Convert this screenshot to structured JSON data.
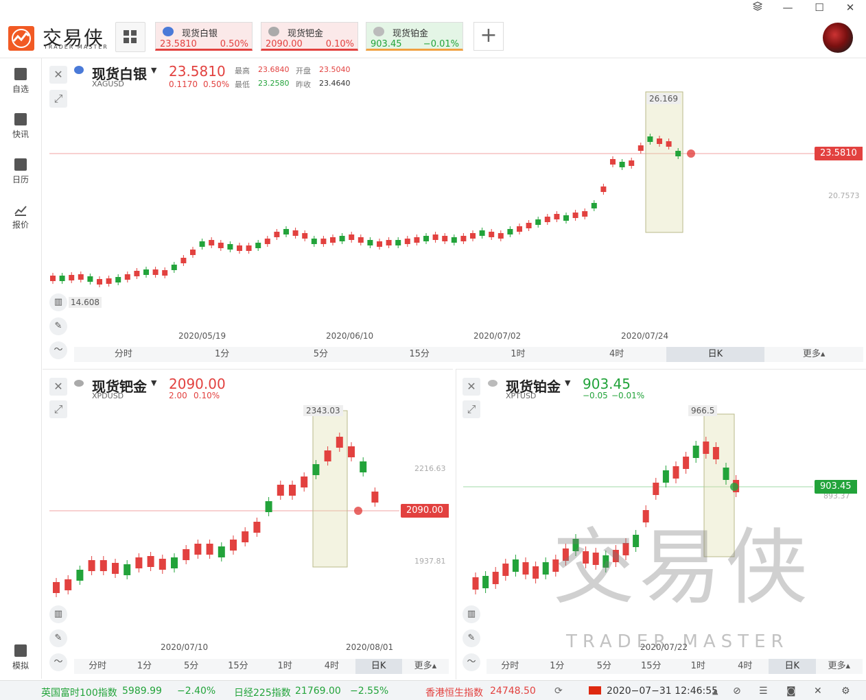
{
  "app": {
    "logo_text": "交易侠",
    "logo_sub": "TRADER MASTER",
    "watermark_text": "交易侠",
    "watermark_sub": "TRADER MASTER"
  },
  "window_controls": {
    "layers_icon": "layers-icon",
    "min": "—",
    "max": "☐",
    "close": "✕"
  },
  "tabs": [
    {
      "name": "现货白银",
      "price": "23.5810",
      "change": "0.50%",
      "color": "#e2413f",
      "bg": "#fbe9e9",
      "icon_color": "#4a7ad8"
    },
    {
      "name": "现货钯金",
      "price": "2090.00",
      "change": "0.10%",
      "color": "#e2413f",
      "bg": "#fbe9e9",
      "icon_color": "#aaaaaa"
    },
    {
      "name": "现货铂金",
      "price": "903.45",
      "change": "−0.01%",
      "color": "#22a33a",
      "bg": "#e4f5e6",
      "icon_color": "#bbbbbb"
    }
  ],
  "add_tab": "+",
  "sidebar": {
    "items": [
      {
        "label": "自选",
        "icon": "bookmark-add-icon"
      },
      {
        "label": "快讯",
        "icon": "news-icon"
      },
      {
        "label": "日历",
        "icon": "calendar-icon"
      },
      {
        "label": "报价",
        "icon": "chart-line-icon"
      }
    ],
    "bottom": {
      "label": "模拟",
      "icon": "wallet-icon"
    }
  },
  "silver": {
    "name": "现货白银",
    "symbol": "XAGUSD",
    "price": "23.5810",
    "change": "0.1170",
    "change_pct": "0.50%",
    "high_label": "最高",
    "high": "23.6840",
    "open_label": "开盘",
    "open": "23.5040",
    "low_label": "最低",
    "low": "23.2580",
    "prev_label": "昨收",
    "prev": "23.4640",
    "max_label": "26.169",
    "min_label": "14.608",
    "axis_label": "20.7573",
    "price_tag": "23.5810",
    "dates": [
      "2020/05/19",
      "2020/06/10",
      "2020/07/02",
      "2020/07/24"
    ],
    "timeframes": [
      "分时",
      "1分",
      "5分",
      "15分",
      "1时",
      "4时",
      "日K",
      "更多▴"
    ],
    "active_tf": "日K"
  },
  "palladium": {
    "name": "现货钯金",
    "symbol": "XPDUSD",
    "price": "2090.00",
    "change": "2.00",
    "change_pct": "0.10%",
    "max_label": "2343.03",
    "axis_labels": [
      "2216.63",
      "1937.81"
    ],
    "price_tag": "2090.00",
    "dates": [
      "2020/07/10",
      "2020/08/01"
    ],
    "timeframes": [
      "分时",
      "1分",
      "5分",
      "15分",
      "1时",
      "4时",
      "日K",
      "更多▴"
    ],
    "active_tf": "日K"
  },
  "platinum": {
    "name": "现货铂金",
    "symbol": "XPTUSD",
    "price": "903.45",
    "change": "−0.05",
    "change_pct": "−0.01%",
    "max_label": "966.5",
    "axis_label": "893.37",
    "price_tag": "903.45",
    "dates": [
      "2020/07/22"
    ],
    "timeframes": [
      "分时",
      "1分",
      "5分",
      "15分",
      "1时",
      "4时",
      "日K",
      "更多▴"
    ],
    "active_tf": "日K"
  },
  "statusbar": {
    "ftse_name": "英国富时100指数",
    "ftse_val": "5989.99",
    "ftse_chg": "−2.40%",
    "nikkei_name": "日经225指数",
    "nikkei_val": "21769.00",
    "nikkei_chg": "−2.55%",
    "hsi_name": "香港恒生指数",
    "hsi_val": "24748.50",
    "datetime": "2020−07−31 12:46:55"
  }
}
